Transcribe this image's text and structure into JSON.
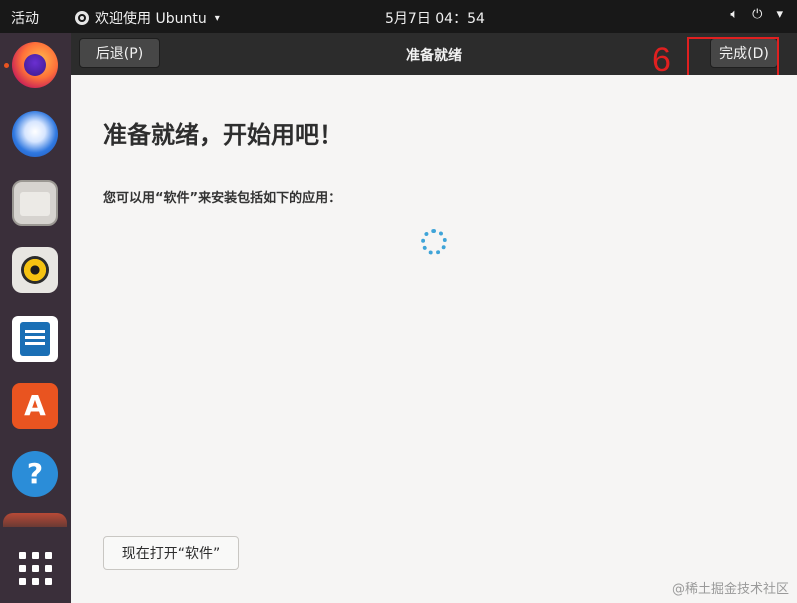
{
  "topbar": {
    "activities": "活动",
    "app_menu": "欢迎使用 Ubuntu",
    "app_menu_caret": "▾",
    "clock": "5月7日  04：54",
    "volume_icon": "volume-icon",
    "power_icon": "power-icon",
    "sys_caret": "▾"
  },
  "dock": {
    "items": [
      "firefox-icon",
      "thunderbird-icon",
      "files-icon",
      "rhythmbox-icon",
      "libreoffice-writer-icon",
      "ubuntu-software-icon",
      "help-icon",
      "partial-app-icon",
      "show-applications-icon"
    ]
  },
  "header": {
    "back_label": "后退(P)",
    "title": "准备就绪",
    "done_label": "完成(D)"
  },
  "annotation": {
    "number": "6",
    "color": "#e02020"
  },
  "main": {
    "heading": "准备就绪，开始用吧！",
    "description": "您可以用“软件”来安装包括如下的应用：",
    "open_software_label": "现在打开“软件”"
  },
  "watermark": "@稀土掘金技术社区",
  "colors": {
    "accent": "#e95420",
    "spinner": "#3fa4d8"
  }
}
